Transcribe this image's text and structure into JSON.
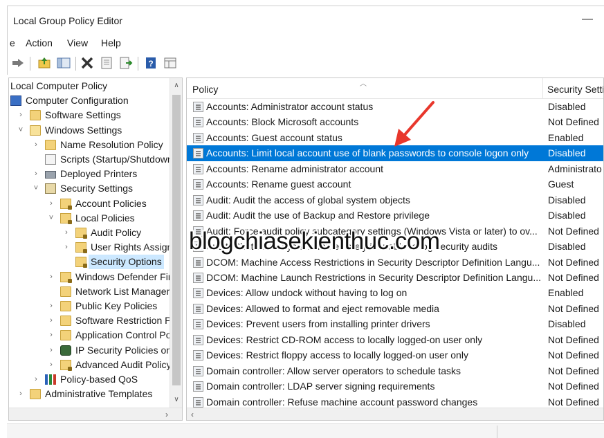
{
  "window": {
    "title": "Local Group Policy Editor",
    "minimize_glyph": "—"
  },
  "menu": {
    "partial_left": "e",
    "items": [
      "Action",
      "View",
      "Help"
    ]
  },
  "toolbar": {
    "icons": [
      "back-arrow-icon",
      "up-folder-icon",
      "show-hide-tree-icon",
      "delete-icon",
      "properties-icon",
      "export-list-icon",
      "help-icon",
      "filter-view-icon"
    ]
  },
  "tree": {
    "items": [
      {
        "label": "Local Computer Policy",
        "level": 0,
        "expander": "",
        "icon": ""
      },
      {
        "label": "Computer Configuration",
        "level": 0,
        "expander": "",
        "icon": "computer-icon"
      },
      {
        "label": "Software Settings",
        "level": 1,
        "expander": "›",
        "icon": "folder-icon"
      },
      {
        "label": "Windows Settings",
        "level": 1,
        "expander": "˅",
        "icon": "folder-open-icon"
      },
      {
        "label": "Name Resolution Policy",
        "level": 2,
        "expander": "›",
        "icon": "folder-icon"
      },
      {
        "label": "Scripts (Startup/Shutdowr",
        "level": 2,
        "expander": "",
        "icon": "script-icon"
      },
      {
        "label": "Deployed Printers",
        "level": 2,
        "expander": "›",
        "icon": "printer-icon"
      },
      {
        "label": "Security Settings",
        "level": 2,
        "expander": "˅",
        "icon": "security-settings-icon"
      },
      {
        "label": "Account Policies",
        "level": 3,
        "expander": "›",
        "icon": "lock-folder-icon"
      },
      {
        "label": "Local Policies",
        "level": 3,
        "expander": "˅",
        "icon": "lock-folder-icon"
      },
      {
        "label": "Audit Policy",
        "level": 4,
        "expander": "›",
        "icon": "lock-folder-icon"
      },
      {
        "label": "User Rights Assign",
        "level": 4,
        "expander": "›",
        "icon": "lock-folder-icon"
      },
      {
        "label": "Security Options",
        "level": 4,
        "expander": "",
        "icon": "lock-folder-icon",
        "selected": true
      },
      {
        "label": "Windows Defender Fir",
        "level": 3,
        "expander": "›",
        "icon": "lock-folder-icon"
      },
      {
        "label": "Network List Manager",
        "level": 3,
        "expander": "",
        "icon": "folder-icon"
      },
      {
        "label": "Public Key Policies",
        "level": 3,
        "expander": "›",
        "icon": "folder-icon"
      },
      {
        "label": "Software Restriction Po",
        "level": 3,
        "expander": "›",
        "icon": "folder-icon"
      },
      {
        "label": "Application Control Po",
        "level": 3,
        "expander": "›",
        "icon": "folder-icon"
      },
      {
        "label": "IP Security Policies on",
        "level": 3,
        "expander": "›",
        "icon": "ip-security-icon"
      },
      {
        "label": "Advanced Audit Policy",
        "level": 3,
        "expander": "›",
        "icon": "lock-folder-icon"
      },
      {
        "label": "Policy-based QoS",
        "level": 2,
        "expander": "›",
        "icon": "qos-chart-icon"
      },
      {
        "label": "Administrative Templates",
        "level": 1,
        "expander": "›",
        "icon": "folder-icon"
      }
    ]
  },
  "list": {
    "col_policy": "Policy",
    "col_setting": "Security Setti",
    "rows": [
      {
        "policy": "Accounts: Administrator account status",
        "setting": "Disabled"
      },
      {
        "policy": "Accounts: Block Microsoft accounts",
        "setting": "Not Defined"
      },
      {
        "policy": "Accounts: Guest account status",
        "setting": "Enabled"
      },
      {
        "policy": "Accounts: Limit local account use of blank passwords to console logon only",
        "setting": "Disabled",
        "selected": true
      },
      {
        "policy": "Accounts: Rename administrator account",
        "setting": "Administrato"
      },
      {
        "policy": "Accounts: Rename guest account",
        "setting": "Guest"
      },
      {
        "policy": "Audit: Audit the access of global system objects",
        "setting": "Disabled"
      },
      {
        "policy": "Audit: Audit the use of Backup and Restore privilege",
        "setting": "Disabled"
      },
      {
        "policy": "Audit: Force audit policy subcategory settings (Windows Vista or later) to ov...",
        "setting": "Not Defined"
      },
      {
        "policy": "Audit: Shut down system immediately if unable to log security audits",
        "setting": "Disabled"
      },
      {
        "policy": "DCOM: Machine Access Restrictions in Security Descriptor Definition Langu...",
        "setting": "Not Defined"
      },
      {
        "policy": "DCOM: Machine Launch Restrictions in Security Descriptor Definition Langu...",
        "setting": "Not Defined"
      },
      {
        "policy": "Devices: Allow undock without having to log on",
        "setting": "Enabled"
      },
      {
        "policy": "Devices: Allowed to format and eject removable media",
        "setting": "Not Defined"
      },
      {
        "policy": "Devices: Prevent users from installing printer drivers",
        "setting": "Disabled"
      },
      {
        "policy": "Devices: Restrict CD-ROM access to locally logged-on user only",
        "setting": "Not Defined"
      },
      {
        "policy": "Devices: Restrict floppy access to locally logged-on user only",
        "setting": "Not Defined"
      },
      {
        "policy": "Domain controller: Allow server operators to schedule tasks",
        "setting": "Not Defined"
      },
      {
        "policy": "Domain controller: LDAP server signing requirements",
        "setting": "Not Defined"
      },
      {
        "policy": "Domain controller: Refuse machine account password changes",
        "setting": "Not Defined"
      }
    ]
  },
  "watermark": "blogchiasekienthuc.com",
  "colors": {
    "selection": "#0078d7",
    "tree_selection": "#cce8ff",
    "arrow": "#e8372c"
  }
}
